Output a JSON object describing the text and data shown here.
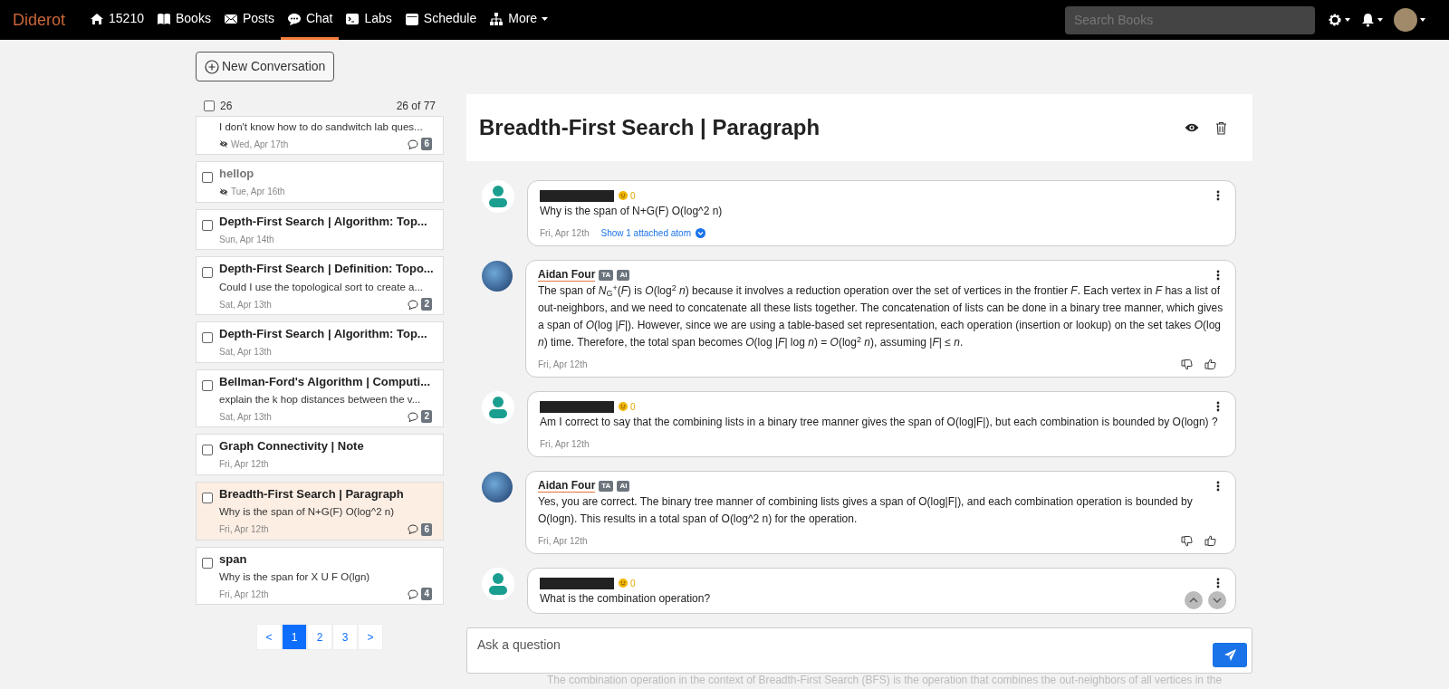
{
  "nav": {
    "logo": "Diderot",
    "items": [
      {
        "label": "15210",
        "selected": false,
        "has_menu": false
      },
      {
        "label": "Books",
        "selected": false,
        "has_menu": false
      },
      {
        "label": "Posts",
        "selected": false,
        "has_menu": false
      },
      {
        "label": "Chat",
        "selected": true,
        "has_menu": false
      },
      {
        "label": "Labs",
        "selected": false,
        "has_menu": false
      },
      {
        "label": "Schedule",
        "selected": false,
        "has_menu": false
      },
      {
        "label": "More",
        "selected": false,
        "has_menu": true
      }
    ],
    "search": {
      "placeholder": "Search Books"
    }
  },
  "new_conversation_button": "New Conversation",
  "sidebar": {
    "select_all": {
      "checked": false,
      "label": "26"
    },
    "range": "26 of 77",
    "conversations": [
      {
        "preview": "I don't know how to do sandwitch lab ques...",
        "date": "Wed, Apr 17th",
        "hidden": true,
        "comments": "6",
        "selected": false
      },
      {
        "title": "hellop",
        "date": "Tue, Apr 16th",
        "hidden": true,
        "checked": false,
        "selected": false
      },
      {
        "title": "Depth-First Search | Algorithm: Top...",
        "date": "Sun, Apr 14th",
        "hidden": false,
        "checked": false,
        "selected": false
      },
      {
        "title": "Depth-First Search | Definition: Topo...",
        "preview": "Could I use the topological sort to create a...",
        "date": "Sat, Apr 13th",
        "hidden": false,
        "comments": "2",
        "checked": false,
        "selected": false
      },
      {
        "title": "Depth-First Search | Algorithm: Top...",
        "date": "Sat, Apr 13th",
        "hidden": false,
        "checked": false,
        "selected": false
      },
      {
        "title": "Bellman-Ford's Algorithm | Computi...",
        "preview": "explain the k hop distances between the v...",
        "date": "Sat, Apr 13th",
        "hidden": false,
        "comments": "2",
        "checked": false,
        "selected": false
      },
      {
        "title": "Graph Connectivity | Note",
        "date": "Fri, Apr 12th",
        "hidden": false,
        "checked": false,
        "selected": false
      },
      {
        "title": "Breadth-First Search | Paragraph",
        "preview": "Why is the span of N+G(F) O(log^2 n)",
        "date": "Fri, Apr 12th",
        "hidden": false,
        "comments": "6",
        "checked": false,
        "selected": true
      },
      {
        "title": "span",
        "preview": "Why is the span for X U F O(lgn)",
        "date": "Fri, Apr 12th",
        "hidden": false,
        "comments": "4",
        "checked": false,
        "selected": false
      }
    ],
    "pagination": [
      {
        "label": "<",
        "selected": false
      },
      {
        "label": "1",
        "selected": true
      },
      {
        "label": "2",
        "selected": false
      },
      {
        "label": "3",
        "selected": false
      },
      {
        "label": ">",
        "selected": false
      }
    ]
  },
  "conversation": {
    "title": "Breadth-First Search | Paragraph",
    "messages": [
      {
        "kind": "student",
        "score": "0",
        "text": "Why is the span of N+G(F) O(log^2 n)",
        "date": "Fri, Apr 12th",
        "attachment_link": "Show 1 attached atom"
      },
      {
        "kind": "ai",
        "author": "Aidan Four",
        "badges": [
          "TA",
          "AI"
        ],
        "text": "The span of *N*$_{G}$$^{+}$(*F*) is *O*(log$^{2}$ *n*) because it involves a reduction operation over the set of vertices in the frontier *F*. Each vertex in *F* has a list of out-neighbors, and we need to concatenate all these lists together. The concatenation of lists can be done in a binary tree manner, which gives a span of *O*(log |*F*|). However, since we are using a table-based set representation, each operation (insertion or lookup) on the set takes *O*(log *n*) time. Therefore, the total span becomes *O*(log |*F*| log *n*) = *O*(log$^{2}$ *n*), assuming |*F*| ≤ *n*.",
        "date": "Fri, Apr 12th"
      },
      {
        "kind": "student",
        "score": "0",
        "text": "Am I correct to say that the combining lists in a binary tree manner gives the span of O(log|F|), but each combination is bounded by O(logn) ?",
        "date": "Fri, Apr 12th"
      },
      {
        "kind": "ai",
        "author": "Aidan Four",
        "badges": [
          "TA",
          "AI"
        ],
        "text": "Yes, you are correct. The binary tree manner of combining lists gives a span of O(log|F|), and each combination operation is bounded by O(logn). This results in a total span of O(log^2 n) for the operation.",
        "date": "Fri, Apr 12th"
      },
      {
        "kind": "student",
        "score": "0",
        "text": "What is the combination operation?"
      }
    ],
    "input": {
      "placeholder": "Ask a question"
    },
    "next_message_text": "The combination operation in the context of Breadth-First Search (BFS) is the operation that combines the out-neighbors of all vertices in the"
  }
}
